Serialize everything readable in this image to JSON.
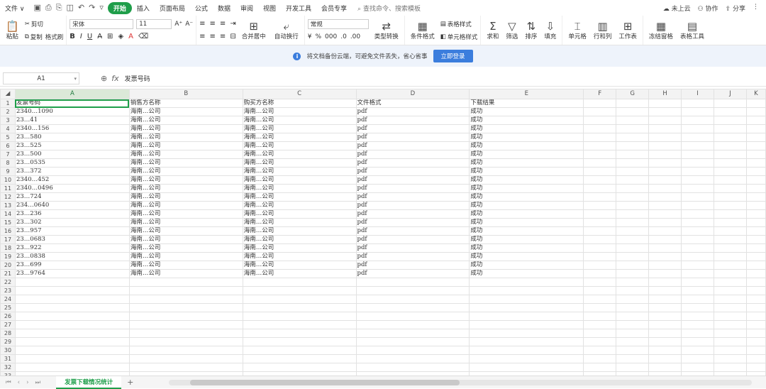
{
  "menu": {
    "file": "文件",
    "tabs": [
      "开始",
      "插入",
      "页面布局",
      "公式",
      "数据",
      "审阅",
      "视图",
      "开发工具",
      "会员专享"
    ],
    "search_placeholder": "查找命令、搜索模板",
    "right": [
      "未上云",
      "协作",
      "分享"
    ]
  },
  "ribbon": {
    "paste": "粘贴",
    "cut": "剪切",
    "copy": "复制",
    "format_painter": "格式刷",
    "font_name": "宋体",
    "font_size": "11",
    "merge_center": "合并居中",
    "wrap_text": "自动换行",
    "number_format": "常规",
    "type_convert": "类型转换",
    "cond_format": "条件格式",
    "table_style": "表格样式",
    "cell_style": "单元格样式",
    "sum": "求和",
    "filter": "筛选",
    "sort": "排序",
    "fill": "填充",
    "cell": "单元格",
    "row_col": "行和列",
    "worksheet": "工作表",
    "freeze": "冻结窗格",
    "table_tools": "表格工具"
  },
  "notice": {
    "text": "将文档备份云端，可避免文件丢失，省心省事",
    "login": "立即登录"
  },
  "formula": {
    "cell_ref": "A1",
    "value": "发票号码"
  },
  "sheet": {
    "columns": [
      "A",
      "B",
      "C",
      "D",
      "E",
      "F",
      "G",
      "H",
      "I",
      "J",
      "K"
    ],
    "header": [
      "发票号码",
      "销售方名称",
      "购买方名称",
      "文件格式",
      "下载结果"
    ],
    "rows": [
      [
        "2340…1090",
        "海南…公司",
        "海南…公司",
        "pdf",
        "成功"
      ],
      [
        "23…41",
        "海南…公司",
        "海南…公司",
        "pdf",
        "成功"
      ],
      [
        "2340…156",
        "海南…公司",
        "海南…公司",
        "pdf",
        "成功"
      ],
      [
        "23…580",
        "海南…公司",
        "海南…公司",
        "pdf",
        "成功"
      ],
      [
        "23…525",
        "海南…公司",
        "海南…公司",
        "pdf",
        "成功"
      ],
      [
        "23…500",
        "海南…公司",
        "海南…公司",
        "pdf",
        "成功"
      ],
      [
        "23…0535",
        "海南…公司",
        "海南…公司",
        "pdf",
        "成功"
      ],
      [
        "23…372",
        "海南…公司",
        "海南…公司",
        "pdf",
        "成功"
      ],
      [
        "2340…452",
        "海南…公司",
        "海南…公司",
        "pdf",
        "成功"
      ],
      [
        "2340…0496",
        "海南…公司",
        "海南…公司",
        "pdf",
        "成功"
      ],
      [
        "23…724",
        "海南…公司",
        "海南…公司",
        "pdf",
        "成功"
      ],
      [
        "234…0640",
        "海南…公司",
        "海南…公司",
        "pdf",
        "成功"
      ],
      [
        "23…236",
        "海南…公司",
        "海南…公司",
        "pdf",
        "成功"
      ],
      [
        "23…302",
        "海南…公司",
        "海南…公司",
        "pdf",
        "成功"
      ],
      [
        "23…957",
        "海南…公司",
        "海南…公司",
        "pdf",
        "成功"
      ],
      [
        "23…0683",
        "海南…公司",
        "海南…公司",
        "pdf",
        "成功"
      ],
      [
        "23…922",
        "海南…公司",
        "海南…公司",
        "pdf",
        "成功"
      ],
      [
        "23…0838",
        "海南…公司",
        "海南…公司",
        "pdf",
        "成功"
      ],
      [
        "23…699",
        "海南…公司",
        "海南…公司",
        "pdf",
        "成功"
      ],
      [
        "23…9764",
        "海南…公司",
        "海南…公司",
        "pdf",
        "成功"
      ]
    ],
    "total_rows": 33,
    "tab_name": "发票下载情况统计"
  }
}
